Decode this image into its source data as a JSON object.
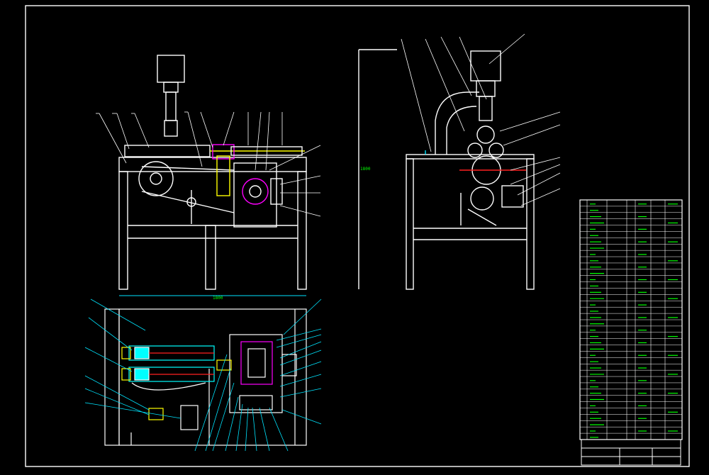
{
  "drawing": {
    "dimension_front_width": "1800",
    "dimension_side_height": "1800",
    "dimension_plan": "1800",
    "rows_count_visible": 38
  },
  "colors": {
    "background": "#000000",
    "outline": "#ffffff",
    "leader": "#00e5ff",
    "accent_yellow": "#ffff00",
    "accent_magenta": "#ff00ff",
    "accent_green": "#00ff00",
    "accent_red": "#ff2020",
    "hatch_cyan": "#00ffff"
  },
  "icons": [
    "motor-icon",
    "pulley-icon",
    "gearbox-icon",
    "roller-icon"
  ]
}
